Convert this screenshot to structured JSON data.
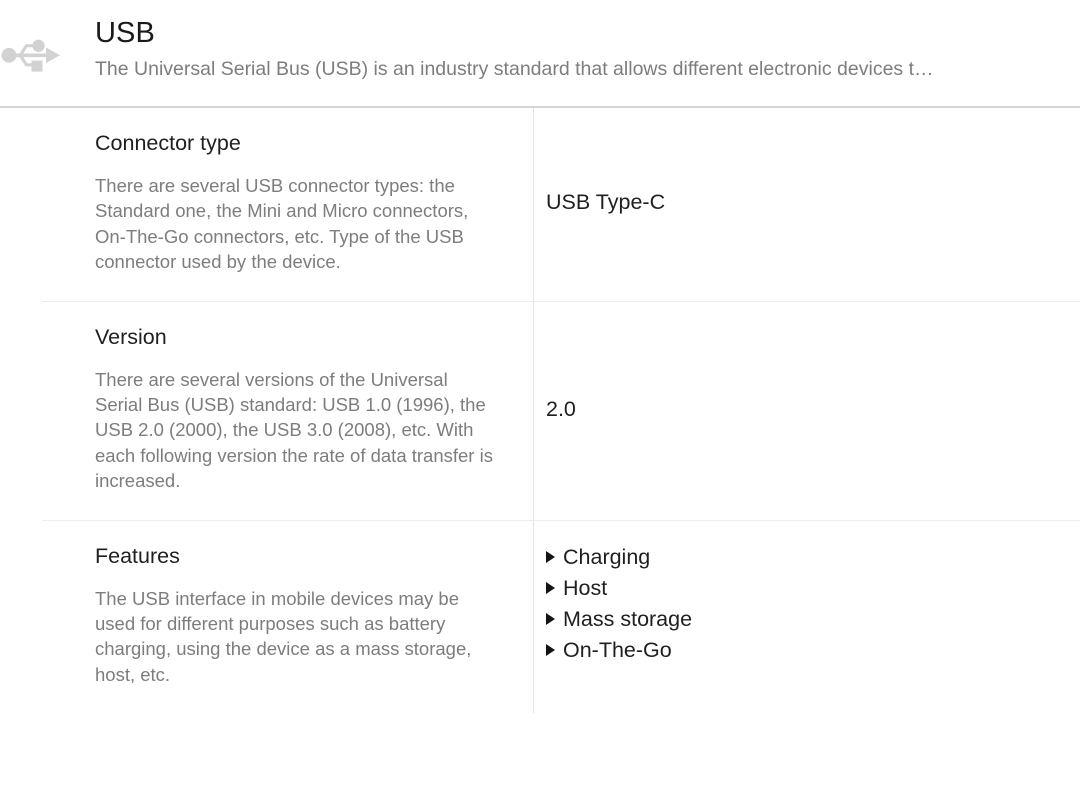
{
  "header": {
    "icon": "usb-icon",
    "title": "USB",
    "subtitle": "The Universal Serial Bus (USB) is an industry standard that allows different electronic devices t…"
  },
  "colors": {
    "title_text": "#1a1a1a",
    "body_text": "#1f1f1f",
    "muted_text": "#7d7d7d",
    "header_divider": "#d4d4d4",
    "row_divider": "#ececed",
    "column_divider": "#e4e4e4",
    "icon": "#d0d0d0",
    "background": "#ffffff"
  },
  "spec_rows": [
    {
      "name": "Connector type",
      "description": "There are several USB connector types: the Standard one, the Mini and Micro connectors, On-The-Go connectors, etc. Type of the USB connector used by the device.",
      "value": "USB Type-C"
    },
    {
      "name": "Version",
      "description": "There are several versions of the Universal Serial Bus (USB) standard: USB 1.0 (1996), the USB 2.0 (2000), the USB 3.0 (2008), etc. With each following version the rate of data transfer is increased.",
      "value": "2.0"
    },
    {
      "name": "Features",
      "description": "The USB interface in mobile devices may be used for different purposes such as battery charging, using the device as a mass storage, host, etc.",
      "values": [
        "Charging",
        "Host",
        "Mass storage",
        "On-The-Go"
      ]
    }
  ]
}
